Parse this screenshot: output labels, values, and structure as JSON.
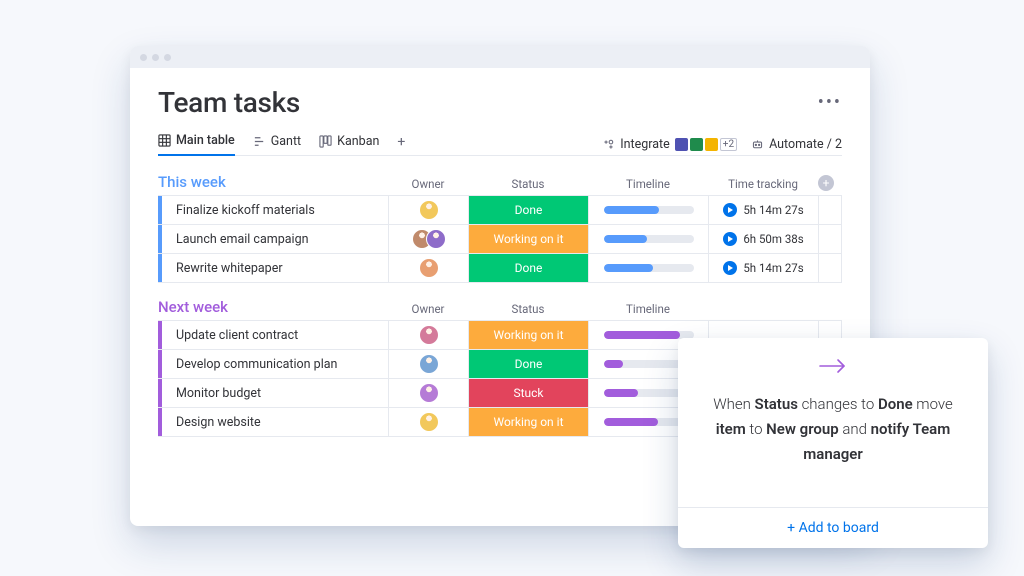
{
  "header": {
    "title": "Team tasks",
    "tabs": [
      {
        "label": "Main table",
        "icon": "grid-icon",
        "active": true
      },
      {
        "label": "Gantt",
        "icon": "gantt-icon",
        "active": false
      },
      {
        "label": "Kanban",
        "icon": "kanban-icon",
        "active": false
      }
    ],
    "integrate_label": "Integrate",
    "integrate_extra": "+2",
    "automate_label": "Automate / 2"
  },
  "columns": {
    "owner": "Owner",
    "status": "Status",
    "timeline": "Timeline",
    "time_tracking": "Time tracking"
  },
  "groups": [
    {
      "title": "This week",
      "color": "blue",
      "show_tracking": true,
      "rows": [
        {
          "name": "Finalize kickoff materials",
          "owners": 1,
          "status": "Done",
          "status_class": "st-done",
          "timeline_pct": 62,
          "track": "5h 14m 27s"
        },
        {
          "name": "Launch email campaign",
          "owners": 2,
          "status": "Working on it",
          "status_class": "st-working",
          "timeline_pct": 48,
          "track": "6h 50m 38s"
        },
        {
          "name": "Rewrite whitepaper",
          "owners": 1,
          "status": "Done",
          "status_class": "st-done",
          "timeline_pct": 55,
          "track": "5h 14m 27s"
        }
      ]
    },
    {
      "title": "Next week",
      "color": "purple",
      "show_tracking": false,
      "rows": [
        {
          "name": "Update client contract",
          "owners": 1,
          "status": "Working on it",
          "status_class": "st-working",
          "timeline_pct": 85
        },
        {
          "name": "Develop communication plan",
          "owners": 1,
          "status": "Done",
          "status_class": "st-done",
          "timeline_pct": 22
        },
        {
          "name": "Monitor budget",
          "owners": 1,
          "status": "Stuck",
          "status_class": "st-stuck",
          "timeline_pct": 38
        },
        {
          "name": "Design website",
          "owners": 1,
          "status": "Working on it",
          "status_class": "st-working",
          "timeline_pct": 60
        }
      ]
    }
  ],
  "automation": {
    "text_parts": [
      "When ",
      "Status",
      " changes to ",
      "Done",
      " move ",
      "item",
      " to ",
      "New group",
      " and ",
      "notify Team manager"
    ],
    "bold_indices": [
      1,
      3,
      5,
      7,
      9
    ],
    "add_label": "+ Add to board"
  },
  "avatar_colors": [
    "#f2c85b",
    "#c08a6b",
    "#8e6cc9",
    "#e89f71",
    "#d47a9a",
    "#7aa6d6",
    "#b57bd6"
  ]
}
